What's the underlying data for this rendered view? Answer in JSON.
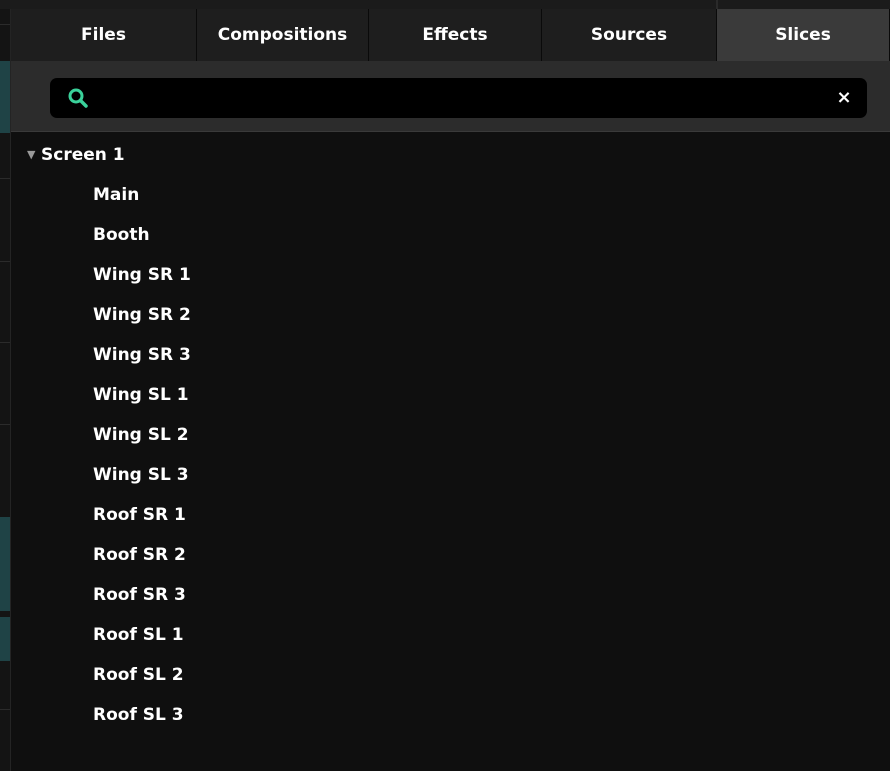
{
  "tabs": [
    {
      "label": "Files",
      "active": false
    },
    {
      "label": "Compositions",
      "active": false
    },
    {
      "label": "Effects",
      "active": false
    },
    {
      "label": "Sources",
      "active": false
    },
    {
      "label": "Slices",
      "active": true
    }
  ],
  "search": {
    "value": "",
    "placeholder": "",
    "icon": "search-icon",
    "clear_icon": "close-icon",
    "clear_glyph": "×"
  },
  "tree": {
    "group": {
      "label": "Screen 1",
      "expanded": true,
      "disclosure_glyph": "▼",
      "items": [
        "Main",
        "Booth",
        "Wing SR 1",
        "Wing SR 2",
        "Wing SR 3",
        "Wing SL 1",
        "Wing SL 2",
        "Wing SL 3",
        "Roof SR 1",
        "Roof SR 2",
        "Roof SR 3",
        "Roof SL 1",
        "Roof SL 2",
        "Roof SL 3"
      ]
    }
  },
  "colors": {
    "accent": "#3ad19a",
    "panel_bg": "#0f0f0f",
    "toolbar_bg": "#2c2c2c",
    "tab_bg": "#1e1e1e",
    "tab_active_bg": "#3a3a3a",
    "text": "#ffffff"
  }
}
